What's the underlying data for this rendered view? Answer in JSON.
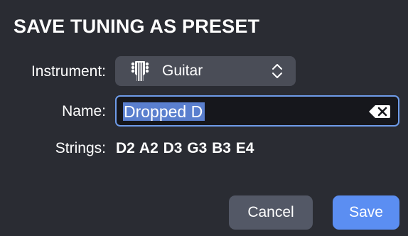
{
  "dialog": {
    "title": "SAVE TUNING AS PRESET"
  },
  "instrument": {
    "label": "Instrument:",
    "selected": "Guitar",
    "icon": "guitar-headstock-icon"
  },
  "name": {
    "label": "Name:",
    "value": "Dropped D",
    "selected_all": true,
    "clear_icon": "clear-text-icon"
  },
  "strings": {
    "label": "Strings:",
    "value": "D2 A2 D3 G3 B3 E4"
  },
  "buttons": {
    "cancel": "Cancel",
    "save": "Save"
  },
  "colors": {
    "background": "#2a2c33",
    "accent": "#5b8ef2",
    "focus_ring": "#6e9be8",
    "selection": "#5a7fce"
  }
}
